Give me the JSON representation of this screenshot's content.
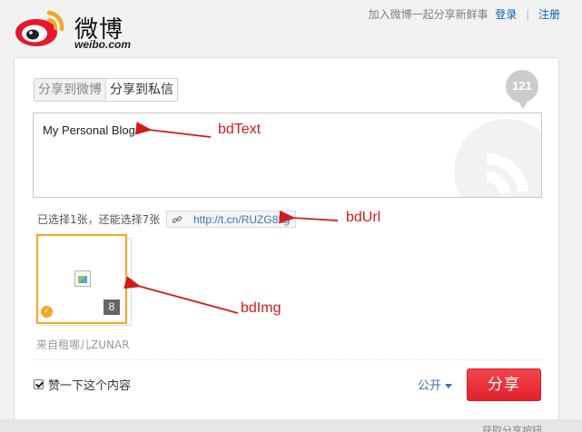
{
  "header": {
    "logo_cn": "微博",
    "logo_en": "weibo.com",
    "slogan": "加入微博一起分享新鲜事",
    "login": "登录",
    "separator": "|",
    "register": "注册"
  },
  "composer": {
    "tabs": [
      {
        "label": "分享到微博",
        "active": true
      },
      {
        "label": "分享到私信",
        "active": false
      }
    ],
    "char_count": "121",
    "text": "My Personal Blog",
    "selection_info": "已选择1张，还能选择7张",
    "url": "http://t.cn/RUZG8xg",
    "image_count": "8",
    "source": "来自租哪儿ZUNAR",
    "like_label": "赞一下这个内容",
    "visibility": "公开",
    "share_button": "分享",
    "footer_text": "获取分享按钮"
  },
  "annotations": {
    "text": "bdText",
    "url": "bdUrl",
    "img": "bdImg",
    "color": "#d11b1b"
  },
  "colors": {
    "accent": "#e0222b",
    "link": "#0a63b5",
    "selected_border": "#f5a623"
  }
}
